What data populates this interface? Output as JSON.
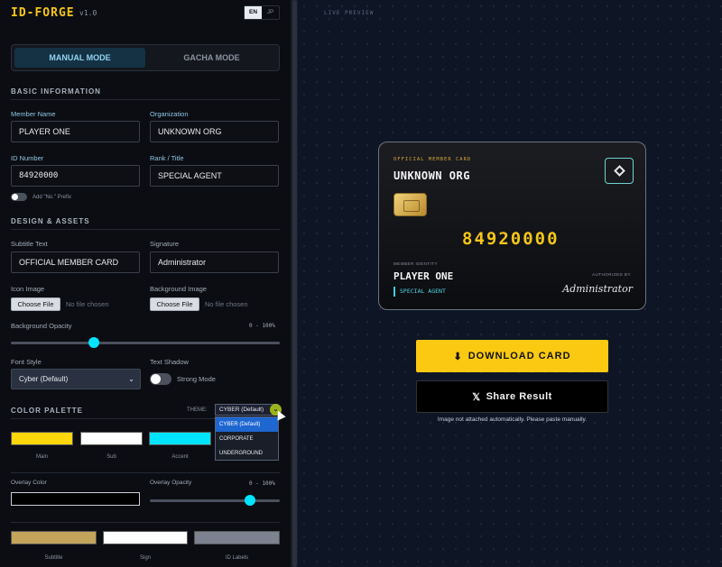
{
  "app": {
    "title": "ID-FORGE",
    "version": "v1.0"
  },
  "lang": {
    "en": "EN",
    "jp": "JP"
  },
  "modes": {
    "manual": "MANUAL MODE",
    "gacha": "GACHA MODE"
  },
  "basic": {
    "title": "BASIC INFORMATION",
    "member_name_label": "Member Name",
    "member_name_value": "PLAYER ONE",
    "organization_label": "Organization",
    "organization_value": "UNKNOWN ORG",
    "id_number_label": "ID Number",
    "id_number_value": "84920000",
    "rank_label": "Rank / Title",
    "rank_value": "SPECIAL AGENT",
    "prefix_label": "Add \"No.\" Prefix"
  },
  "design": {
    "title": "DESIGN & ASSETS",
    "subtitle_label": "Subtitle Text",
    "subtitle_value": "OFFICIAL MEMBER CARD",
    "signature_label": "Signature",
    "signature_value": "Administrator",
    "icon_label": "Icon Image",
    "bg_label": "Background Image",
    "choose_file": "Choose File",
    "no_file": "No file chosen",
    "bg_opacity_label": "Background Opacity",
    "bg_opacity_range": "0 - 100%",
    "bg_opacity_value": 0.31,
    "font_style_label": "Font Style",
    "font_style_value": "Cyber (Default)",
    "text_shadow_label": "Text Shadow",
    "strong_mode_label": "Strong Mode"
  },
  "palette": {
    "title": "COLOR PALETTE",
    "theme_label": "THEME:",
    "theme_value": "CYBER (Default)",
    "theme_options": [
      "CYBER (Default)",
      "CORPORATE",
      "UNDERGROUND"
    ],
    "swatches": [
      {
        "label": "Main",
        "color": "#ffd60a"
      },
      {
        "label": "Sub",
        "color": "#ffffff"
      },
      {
        "label": "Accent",
        "color": "#00e5ff"
      }
    ],
    "overlay_color_label": "Overlay Color",
    "overlay_color": "#000000",
    "overlay_opacity_label": "Overlay Opacity",
    "overlay_opacity_range": "0 - 100%",
    "overlay_opacity_value": 0.77,
    "swatches2": [
      {
        "label": "Subtitle",
        "color": "#c4a45a"
      },
      {
        "label": "Sign",
        "color": "#ffffff"
      },
      {
        "label": "ID Labels",
        "color": "#7d8290"
      }
    ]
  },
  "preview": {
    "label": "LIVE PREVIEW",
    "card": {
      "subtitle": "OFFICIAL MEMBER CARD",
      "org": "UNKNOWN ORG",
      "id": "84920000",
      "member_identity": "MEMBER IDENTITY",
      "name": "PLAYER ONE",
      "rank": "SPECIAL AGENT",
      "authorized": "AUTHORIZED BY",
      "signature": "Administrator"
    },
    "download_label": "DOWNLOAD CARD",
    "share_label": "Share Result",
    "note": "Image not attached automatically. Please paste manually."
  },
  "colors": {
    "accent": "#00e5ff",
    "brand": "#f5c518",
    "download_bg": "#fcc912"
  }
}
